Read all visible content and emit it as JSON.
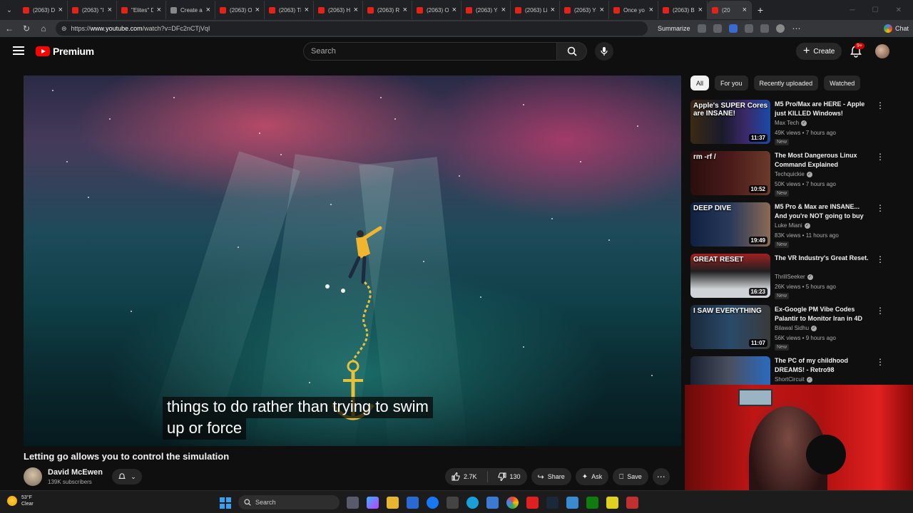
{
  "browser": {
    "tabs": [
      {
        "title": "(2063) D",
        "favicon": "youtube-favicon"
      },
      {
        "title": "(2063) \"I",
        "favicon": "youtube-favicon"
      },
      {
        "title": "\"Elites\" D",
        "favicon": "youtube-favicon"
      },
      {
        "title": "Create a",
        "favicon": "page-favicon"
      },
      {
        "title": "(2063) O",
        "favicon": "youtube-favicon"
      },
      {
        "title": "(2063) Th",
        "favicon": "youtube-favicon"
      },
      {
        "title": "(2063) H",
        "favicon": "youtube-favicon"
      },
      {
        "title": "(2063) R",
        "favicon": "youtube-favicon"
      },
      {
        "title": "(2063) O",
        "favicon": "youtube-favicon"
      },
      {
        "title": "(2063) Yc",
        "favicon": "youtube-favicon"
      },
      {
        "title": "(2063) Li",
        "favicon": "youtube-favicon"
      },
      {
        "title": "(2063) Yc",
        "favicon": "youtube-favicon"
      },
      {
        "title": "Once yo",
        "favicon": "youtube-favicon"
      },
      {
        "title": "(2063) B",
        "favicon": "youtube-favicon"
      },
      {
        "title": "(20",
        "favicon": "youtube-favicon",
        "active": true
      }
    ],
    "url_prefix": "https://",
    "url_host": "www.youtube.com",
    "url_path": "/watch?v=DFc2nCTjVqI",
    "summarize_label": "Summarize",
    "chat_label": "Chat"
  },
  "youtube": {
    "brand": "Premium",
    "search_placeholder": "Search",
    "create_label": "Create",
    "notification_badge": "9+",
    "video": {
      "subtitle_line1": "things to do rather than trying to swim",
      "subtitle_line2": "up or force",
      "title": "Letting go allows you to control the simulation",
      "channel": "David McEwen",
      "subscribers": "139K subscribers",
      "likes": "2.7K",
      "dislikes": "130",
      "share_label": "Share",
      "ask_label": "Ask",
      "save_label": "Save"
    },
    "chips": [
      "All",
      "For you",
      "Recently uploaded",
      "Watched"
    ],
    "recommendations": [
      {
        "title": "M5 Pro/Max are HERE - Apple just KILLED Windows!",
        "channel": "Max Tech",
        "meta": "49K views • 7 hours ago",
        "badge": "New",
        "duration": "11:37",
        "thumb_text": "Apple's SUPER Cores are INSANE!"
      },
      {
        "title": "The Most Dangerous Linux Command Explained",
        "channel": "Techquickie",
        "meta": "50K views • 7 hours ago",
        "badge": "New",
        "duration": "10:52",
        "thumb_text": "rm -rf /"
      },
      {
        "title": "M5 Pro & Max are INSANE... And you're NOT going to buy ...",
        "channel": "Luke Miani",
        "meta": "83K views • 11 hours ago",
        "badge": "New",
        "duration": "19:49",
        "thumb_text": "DEEP DIVE"
      },
      {
        "title": "The VR Industry's Great Reset.",
        "channel": "ThrillSeeker",
        "meta": "26K views • 5 hours ago",
        "badge": "New",
        "duration": "16:23",
        "thumb_text": "GREAT RESET"
      },
      {
        "title": "Ex-Google PM Vibe Codes Palantir to Monitor Iran in 4D",
        "channel": "Bilawal Sidhu",
        "meta": "56K views • 9 hours ago",
        "badge": "New",
        "duration": "11:07",
        "thumb_text": "I SAW EVERYTHING"
      },
      {
        "title": "The PC of my childhood DREAMS! - Retro98",
        "channel": "ShortCircuit",
        "meta": "",
        "badge": "",
        "duration": "",
        "thumb_text": ""
      }
    ]
  },
  "taskbar": {
    "temperature": "53°F",
    "condition": "Clear",
    "search_label": "Search"
  },
  "colors": {
    "accent": "#ff0000",
    "background": "#0f0f0f",
    "chip_active": "#f1f1f1"
  }
}
